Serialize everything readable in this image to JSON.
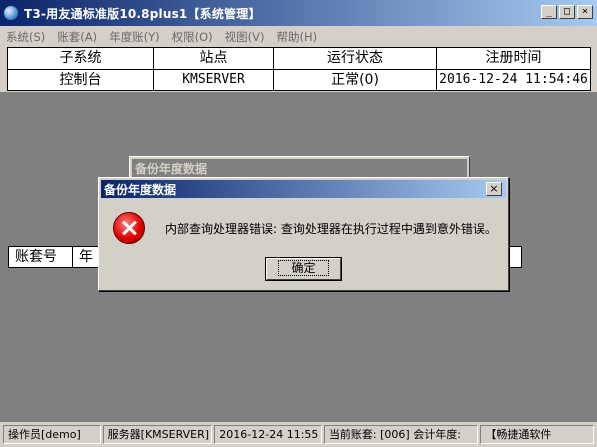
{
  "window": {
    "title": "T3-用友通标准版10.8plus1【系统管理】",
    "buttons": {
      "minimize": "_",
      "maximize": "□",
      "close": "×"
    }
  },
  "menu": [
    {
      "label": "系统(S)"
    },
    {
      "label": "账套(A)"
    },
    {
      "label": "年度账(Y)"
    },
    {
      "label": "权限(O)"
    },
    {
      "label": "视图(V)"
    },
    {
      "label": "帮助(H)"
    }
  ],
  "table": {
    "headers": [
      "子系统",
      "站点",
      "运行状态",
      "注册时间"
    ],
    "rows": [
      [
        "控制台",
        "KMSERVER",
        "正常(0)",
        "2016-12-24 11:54:46"
      ]
    ]
  },
  "lower_table": {
    "headers": [
      "账套号",
      "年"
    ]
  },
  "background_dialog": {
    "title": "备份年度数据"
  },
  "dialog": {
    "title": "备份年度数据",
    "close": "×",
    "icon": "error-icon",
    "message": "内部查询处理器错误: 查询处理器在执行过程中遇到意外错误。",
    "ok_label": "确定"
  },
  "statusbar": {
    "operator": "操作员[demo]",
    "server": "服务器[KMSERVER]",
    "datetime": "2016-12-24 11:55",
    "account": "当前账套: [006] 会计年度:",
    "company": "【畅捷通软件"
  }
}
